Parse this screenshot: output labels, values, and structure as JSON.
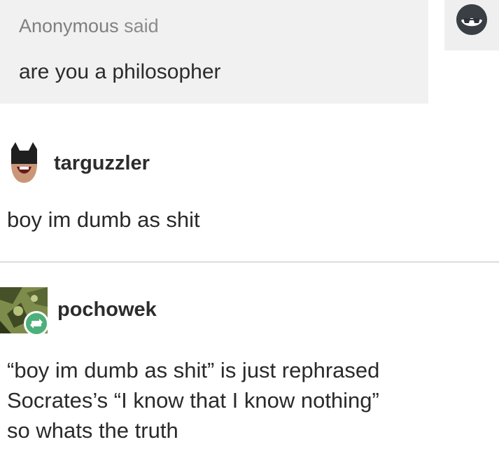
{
  "ask": {
    "asker": "Anonymous",
    "said": "said",
    "question": "are you a philosopher"
  },
  "icons": {
    "anon_avatar": "sunglasses-avatar-icon",
    "targuzzler_avatar": "batman-avatar-icon",
    "pochowek_avatar": "green-art-avatar-icon",
    "reblog_badge": "reblog-icon"
  },
  "colors": {
    "ask_background": "#f1f1f1",
    "reblog_badge": "#4db07a"
  },
  "replies": [
    {
      "username": "targuzzler",
      "text": "boy im dumb as shit"
    },
    {
      "username": "pochowek",
      "lines": [
        "“boy im dumb as shit” is just rephrased",
        "Socrates’s “I know that I know nothing”",
        "so whats the truth"
      ]
    }
  ]
}
